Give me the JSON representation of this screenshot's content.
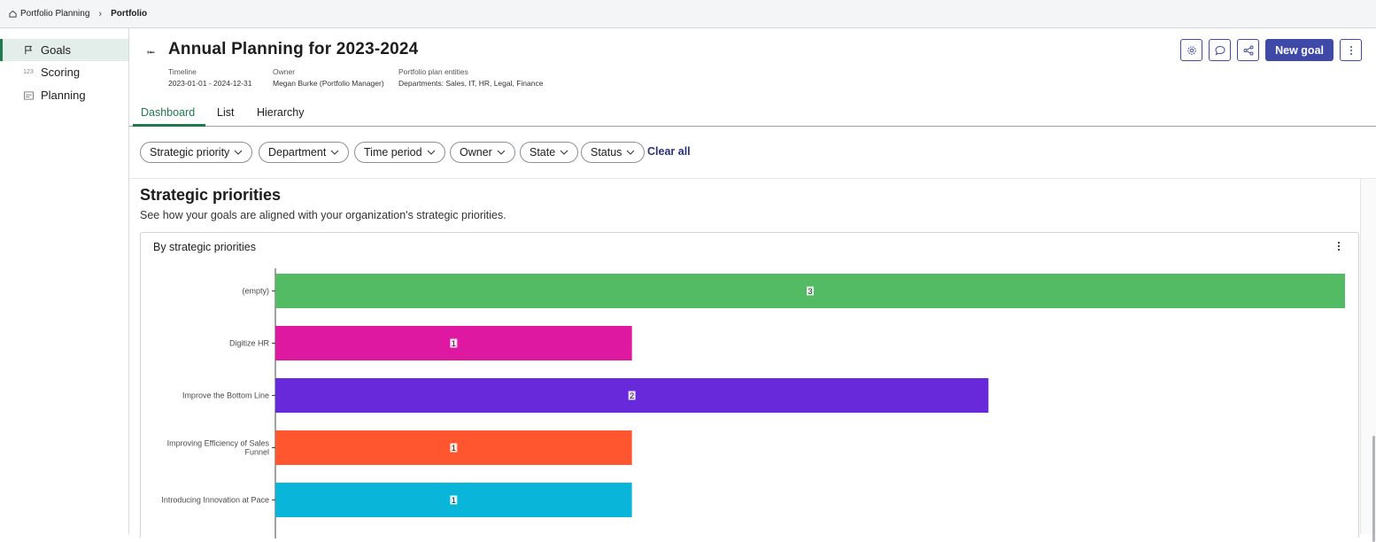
{
  "breadcrumb": {
    "root": "Portfolio Planning",
    "current": "Portfolio",
    "home_icon": "home-icon"
  },
  "sidebar": {
    "items": [
      {
        "label": "Goals",
        "icon": "flag-icon",
        "active": true
      },
      {
        "label": "Scoring",
        "icon": "number-icon",
        "active": false
      },
      {
        "label": "Planning",
        "icon": "calendar-icon",
        "active": false
      }
    ]
  },
  "header": {
    "title": "Annual Planning for 2023-2024",
    "timeline_label": "Timeline",
    "timeline_value": "2023-01-01 - 2024-12-31",
    "owner_label": "Owner",
    "owner_value": "Megan Burke (Portfolio Manager)",
    "entities_label": "Portfolio plan entities",
    "entities_value": "Departments: Sales, IT, HR, Legal, Finance",
    "new_goal_label": "New goal"
  },
  "tabs": [
    "Dashboard",
    "List",
    "Hierarchy"
  ],
  "filters": [
    "Strategic priority",
    "Department",
    "Time period",
    "Owner",
    "State",
    "Status"
  ],
  "clear_all_label": "Clear all",
  "section": {
    "title": "Strategic priorities",
    "subtitle": "See how your goals are aligned with your organization's strategic priorities.",
    "card_title": "By strategic priorities"
  },
  "chart_data": {
    "type": "bar",
    "orientation": "horizontal",
    "categories": [
      "(empty)",
      "Digitize HR",
      "Improve the Bottom Line",
      "Improving Efficiency of Sales Funnel",
      "Introducing Innovation at Pace"
    ],
    "values": [
      3,
      1,
      2,
      1,
      1
    ],
    "colors": [
      "#52bb63",
      "#de18a0",
      "#6729d9",
      "#ff5630",
      "#09b5d9"
    ],
    "xlim": [
      0,
      3
    ],
    "data_labels": true,
    "grid": false
  }
}
